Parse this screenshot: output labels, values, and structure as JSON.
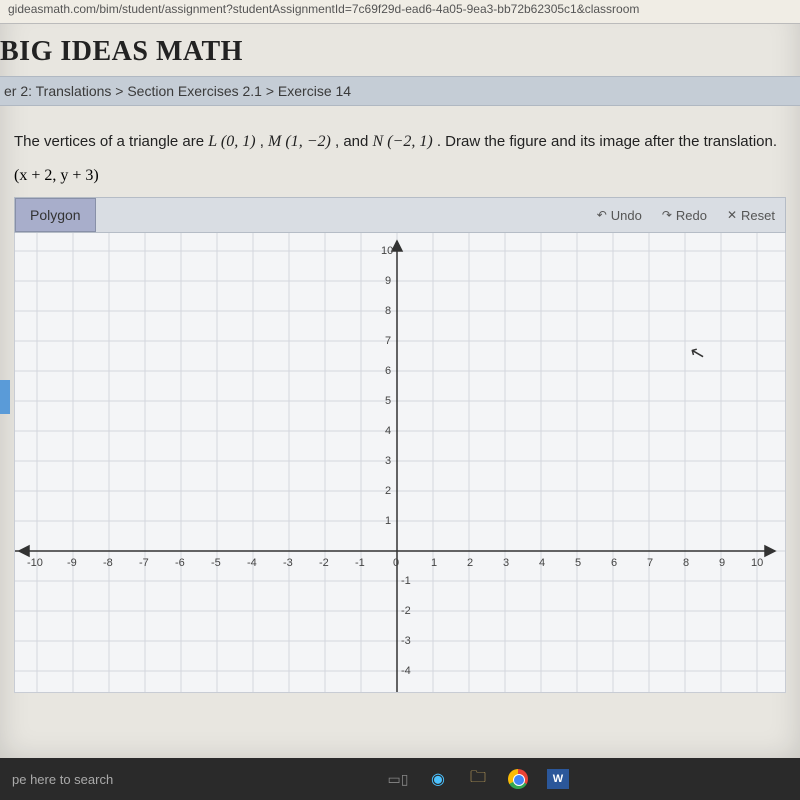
{
  "url": "gideasmath.com/bim/student/assignment?studentAssignmentId=7c69f29d-ead6-4a05-9ea3-bb72b62305c1&classroom",
  "app_title": "BIG IDEAS MATH",
  "breadcrumb": "er 2: Translations > Section Exercises 2.1 > Exercise 14",
  "problem": {
    "intro": "The vertices of a triangle are ",
    "L": "L (0, 1)",
    "M": "M (1, −2)",
    "N": "N (−2, 1)",
    "outro": ". Draw the figure and its image after the translation.",
    "translation": "(x + 2,  y + 3)"
  },
  "toolbar": {
    "polygon": "Polygon",
    "undo": "Undo",
    "redo": "Redo",
    "reset": "Reset"
  },
  "graph": {
    "x_min": -10,
    "x_max": 10,
    "y_min": -4,
    "y_max": 10,
    "x_ticks": [
      -10,
      -9,
      -8,
      -7,
      -6,
      -5,
      -4,
      -3,
      -2,
      -1,
      0,
      1,
      2,
      3,
      4,
      5,
      6,
      7,
      8,
      9,
      10
    ],
    "y_ticks_pos": [
      10,
      9,
      8,
      7,
      6,
      5,
      4,
      3,
      2,
      1
    ],
    "y_ticks_neg": [
      -1,
      -2,
      -3,
      -4
    ]
  },
  "taskbar": {
    "search": "pe here to search"
  }
}
